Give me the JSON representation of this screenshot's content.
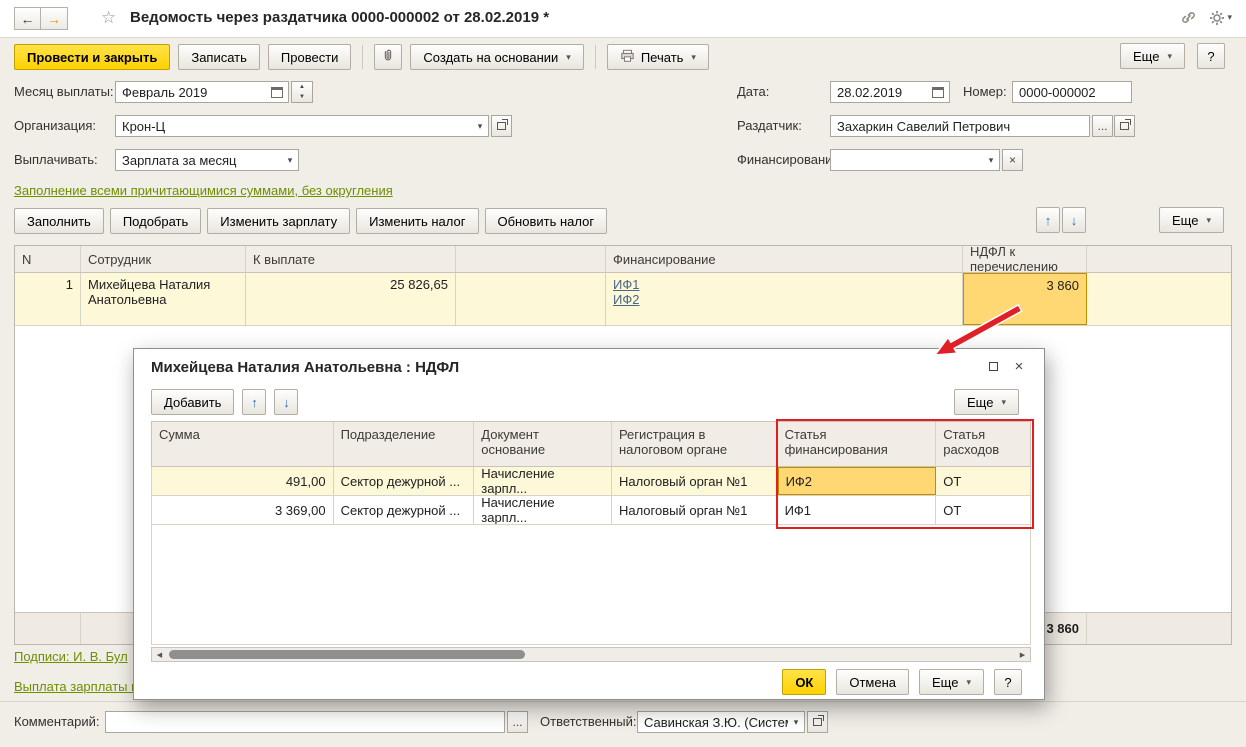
{
  "titlebar": {
    "title": "Ведомость через раздатчика 0000-000002 от 28.02.2019 *"
  },
  "icons": {
    "caret_down": "▾",
    "back_arrow": "←",
    "forward_arrow": "→",
    "star": "☆",
    "move_up": "↑",
    "move_down": "↓",
    "close": "×",
    "ellipsis": "...",
    "clear": "×",
    "scroll_left": "◀",
    "scroll_right": "▶",
    "spin_up": "▲",
    "spin_down": "▼"
  },
  "toolbar": {
    "post_and_close": "Провести и закрыть",
    "write": "Записать",
    "post": "Провести",
    "create_based_on": "Создать на основании",
    "print": "Печать",
    "more": "Еще",
    "help": "?"
  },
  "form": {
    "payout_month": {
      "label": "Месяц выплаты:",
      "value": "Февраль 2019"
    },
    "date": {
      "label": "Дата:",
      "value": "28.02.2019"
    },
    "number": {
      "label": "Номер:",
      "value": "0000-000002"
    },
    "organization": {
      "label": "Организация:",
      "value": "Крон-Ц"
    },
    "dispenser": {
      "label": "Раздатчик:",
      "value": "Захаркин Савелий Петрович"
    },
    "payout_type": {
      "label": "Выплачивать:",
      "value": "Зарплата за месяц"
    },
    "financing": {
      "label": "Финансирование:",
      "value": ""
    },
    "fill_link": "Заполнение всеми причитающимися суммами, без округления"
  },
  "grid_toolbar": {
    "fill": "Заполнить",
    "pick": "Подобрать",
    "change_salary": "Изменить зарплату",
    "change_tax": "Изменить налог",
    "refresh_tax": "Обновить налог",
    "more": "Еще"
  },
  "grid": {
    "headers": {
      "n": "N",
      "employee": "Сотрудник",
      "to_pay": "К выплате",
      "financing": "Финансирование",
      "ndfl": "НДФЛ к перечислению"
    },
    "row": {
      "n": "1",
      "employee": "Михейцева Наталия Анатольевна",
      "to_pay": "25 826,65",
      "financing_links": [
        "ИФ1",
        "ИФ2"
      ],
      "ndfl": "3 860"
    },
    "total_ndfl": "3 860"
  },
  "links": {
    "signatures": "Подписи: И. В. Бул",
    "payout": "Выплата зарплаты и"
  },
  "footer": {
    "comment_label": "Комментарий:",
    "comment_value": "",
    "responsible_label": "Ответственный:",
    "responsible_value": "Савинская З.Ю. (Систем"
  },
  "dialog": {
    "title": "Михейцева Наталия Анатольевна : НДФЛ",
    "add": "Добавить",
    "more": "Еще",
    "headers": [
      "Сумма",
      "Подразделение",
      "Документ основание",
      "Регистрация в налоговом органе",
      "Статья финансирования",
      "Статья расходов"
    ],
    "rows": [
      {
        "sum": "491,00",
        "department": "Сектор дежурной ...",
        "document": "Начисление зарпл...",
        "registration": "Налоговый орган №1",
        "fin_item": "ИФ2",
        "exp_item": "ОТ"
      },
      {
        "sum": "3 369,00",
        "department": "Сектор дежурной ...",
        "document": "Начисление зарпл...",
        "registration": "Налоговый орган №1",
        "fin_item": "ИФ1",
        "exp_item": "ОТ"
      }
    ],
    "ok": "ОК",
    "cancel": "Отмена",
    "help": "?"
  }
}
